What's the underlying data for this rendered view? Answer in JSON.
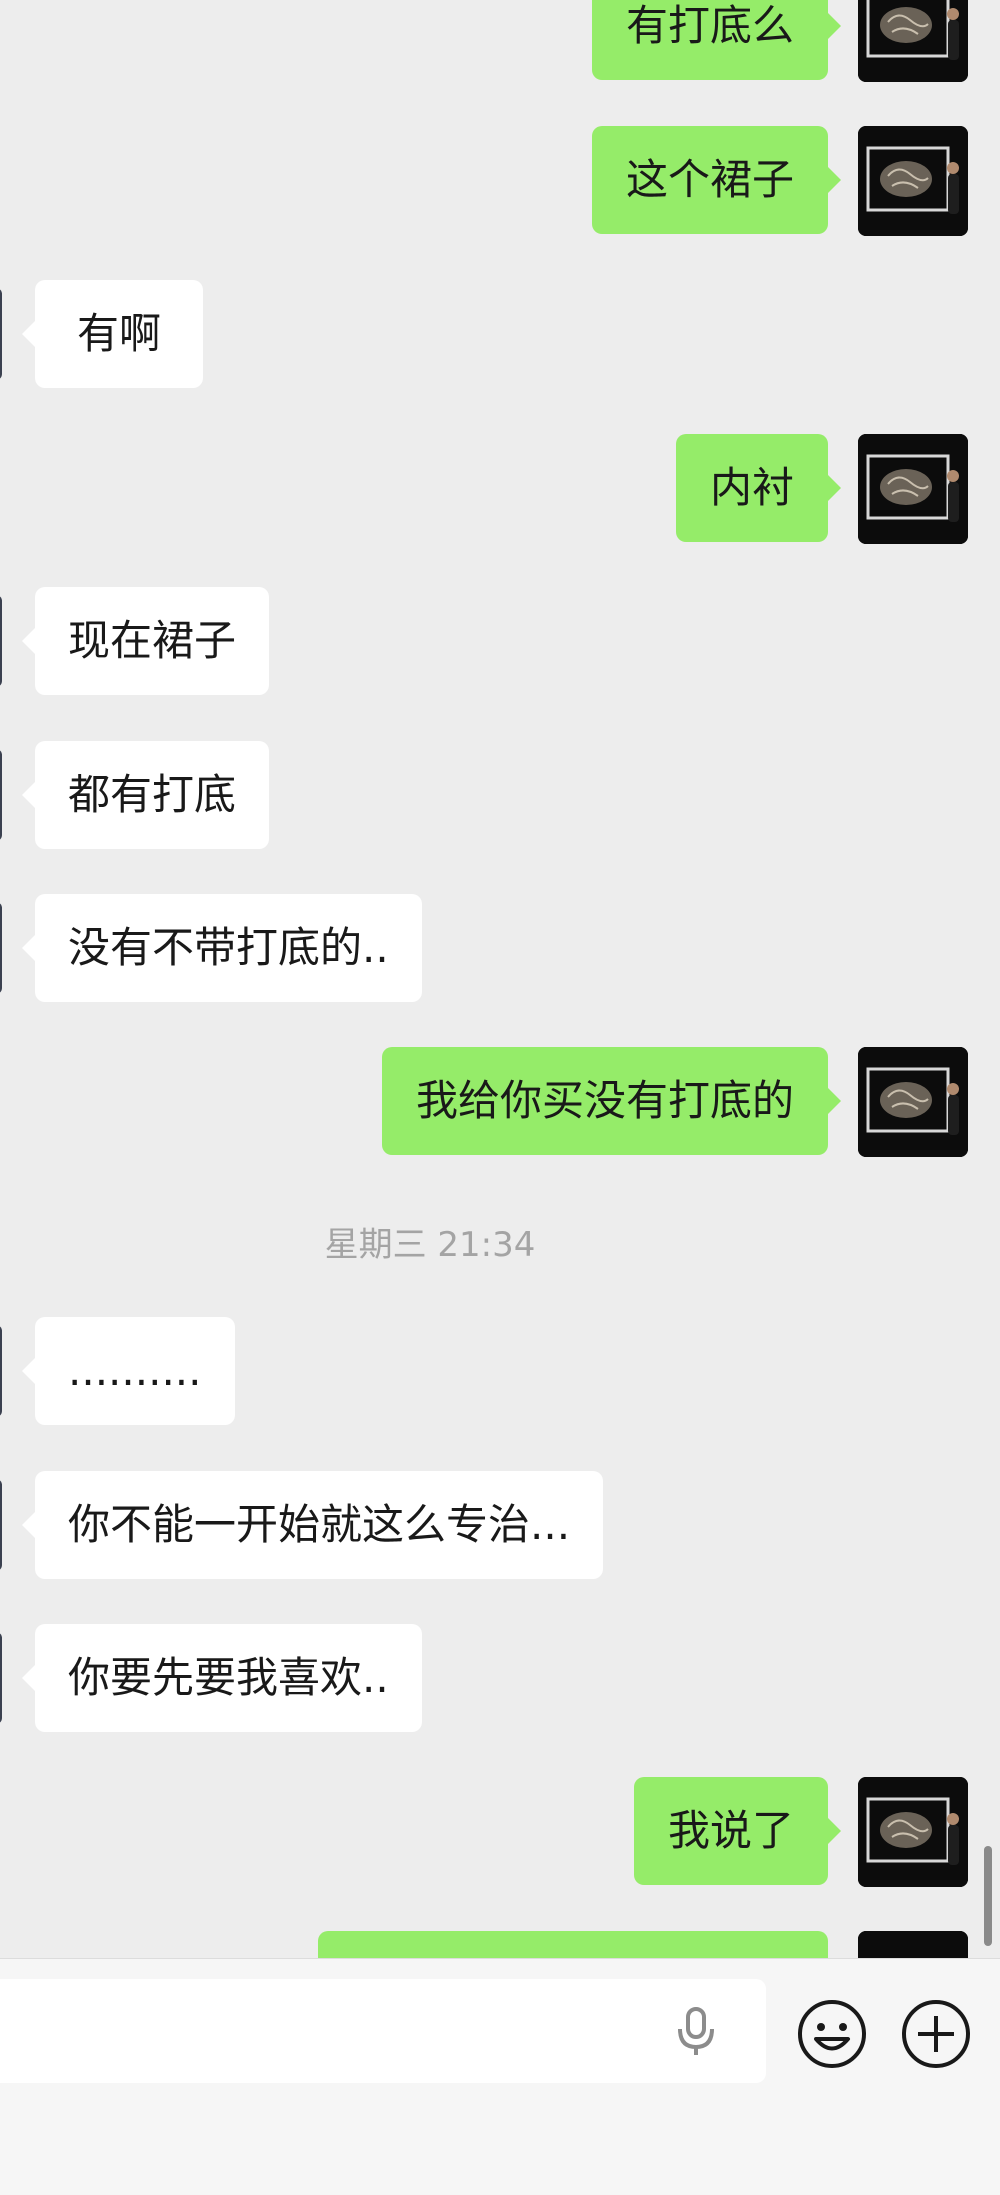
{
  "conversation": {
    "messages": [
      {
        "sender": "me",
        "text": "有打底么"
      },
      {
        "sender": "me",
        "text": "这个裙子"
      },
      {
        "sender": "them",
        "text": "有啊"
      },
      {
        "sender": "me",
        "text": "内衬"
      },
      {
        "sender": "them",
        "text": "现在裙子"
      },
      {
        "sender": "them",
        "text": "都有打底"
      },
      {
        "sender": "them",
        "text": "没有不带打底的.."
      },
      {
        "sender": "me",
        "text": "我给你买没有打底的"
      },
      {
        "sender": "them",
        "text": ".........."
      },
      {
        "sender": "them",
        "text": "你不能一开始就这么专治..."
      },
      {
        "sender": "them",
        "text": "你要先要我喜欢.."
      },
      {
        "sender": "me",
        "text": "我说了"
      },
      {
        "sender": "me",
        "text": ""
      }
    ],
    "timestamp": "星期三 21:34"
  },
  "input_bar": {
    "placeholder": "",
    "icons": [
      "microphone-icon",
      "emoji-icon",
      "plus-icon"
    ]
  },
  "colors": {
    "background": "#ededed",
    "my_bubble": "#95ec69",
    "their_bubble": "#ffffff",
    "timestamp_text": "#a4a4a4"
  }
}
